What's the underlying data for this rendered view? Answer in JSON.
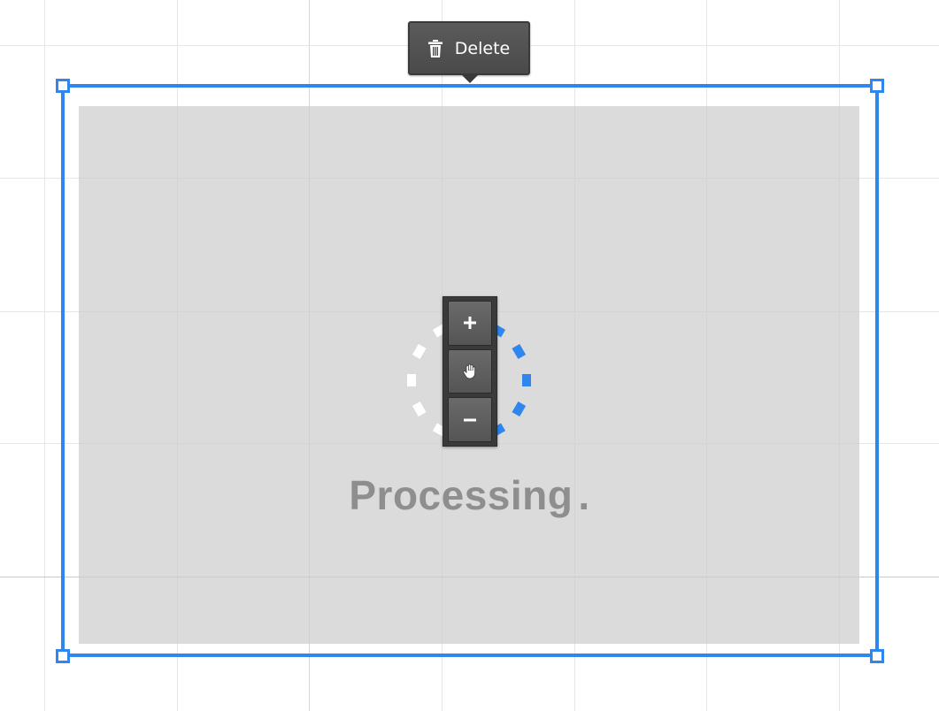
{
  "toolbar": {
    "delete_label": "Delete",
    "delete_icon": "trash-icon"
  },
  "status": {
    "processing_text": "Processing",
    "processing_dots": "."
  },
  "zoom_controls": {
    "zoom_in_icon": "plus-icon",
    "pan_icon": "hand-icon",
    "zoom_out_icon": "minus-icon"
  },
  "colors": {
    "selection_accent": "#2f86ee",
    "spinner_idle": "#ffffff",
    "spinner_active": "#2f86ee",
    "placeholder_fill": "#d9d9d9",
    "text_muted": "#8e8e8e",
    "toolbar_dark": "#3a3a3a"
  }
}
